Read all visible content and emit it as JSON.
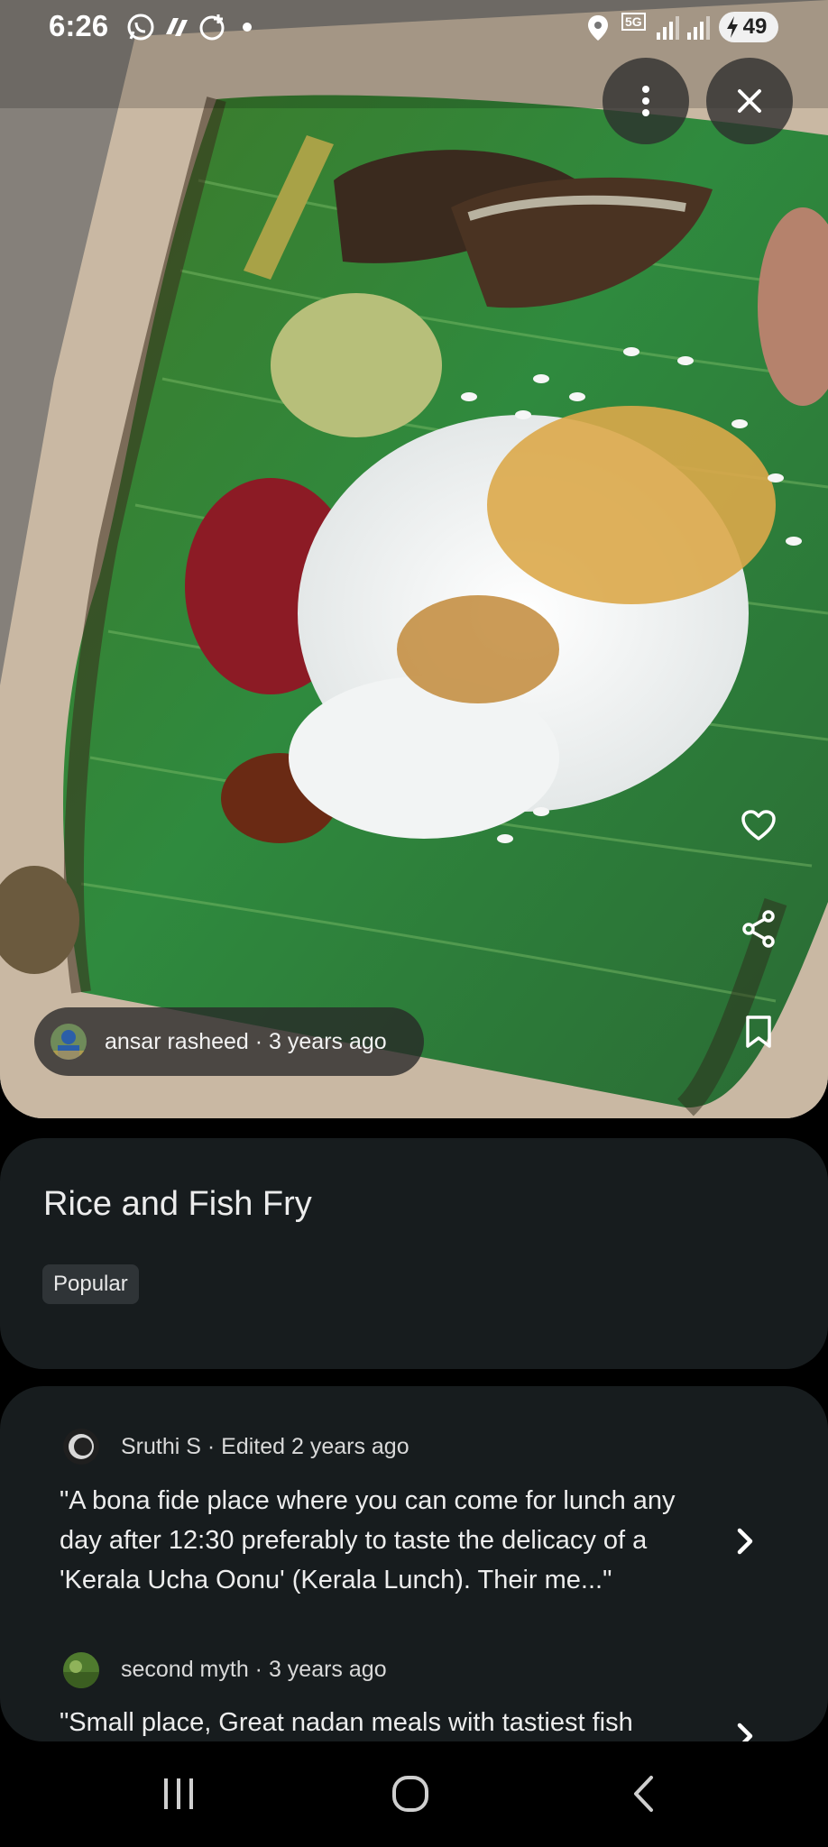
{
  "status_bar": {
    "time": "6:26",
    "network": "5G",
    "battery": "49",
    "icons": [
      "whatsapp-icon",
      "app-icon",
      "whatsapp-business-icon",
      "dot-icon",
      "location-icon",
      "signal-icon",
      "signal-icon",
      "battery-charging-icon"
    ]
  },
  "photo": {
    "author": "ansar rasheed · 3 years ago",
    "actions": [
      "more-options-icon",
      "close-icon",
      "heart-icon",
      "share-icon",
      "bookmark-icon"
    ]
  },
  "dish": {
    "title": "Rice and Fish Fry",
    "badge": "Popular"
  },
  "reviews": [
    {
      "author_line": "Sruthi S · Edited 2 years ago",
      "text": "\"A bona fide place where you can come for lunch any day after 12:30 preferably to taste the delicacy of a 'Kerala Ucha Oonu' (Kerala Lunch). Their me...\""
    },
    {
      "author_line": "second myth · 3 years ago",
      "text": "\"Small place, Great nadan meals with tastiest fish"
    }
  ],
  "nav": [
    "recent-apps-icon",
    "home-icon",
    "back-icon"
  ],
  "colors": {
    "card_bg": "#171c1e",
    "badge_bg": "#2f3437",
    "chip_bg": "#2d2d2d"
  }
}
